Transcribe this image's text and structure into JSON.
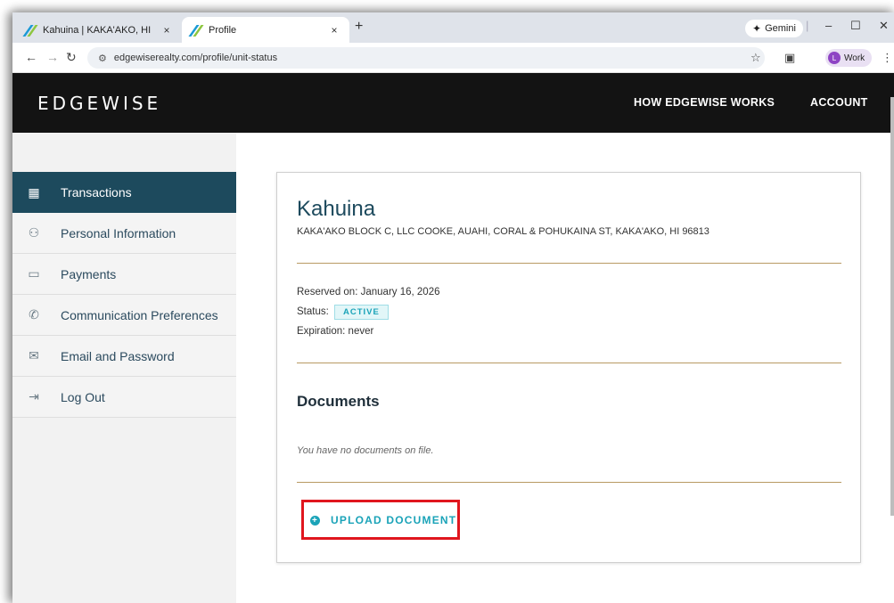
{
  "browser": {
    "tabs": [
      {
        "title": "Kahuina | KAKA'AKO, HI",
        "active": false
      },
      {
        "title": "Profile",
        "active": true
      }
    ],
    "close_glyph": "×",
    "new_tab_glyph": "+",
    "gemini_label": "Gemini",
    "url": "edgewiserealty.com/profile/unit-status",
    "profile_label": "Work",
    "profile_initial": "L"
  },
  "site": {
    "logo": "EDGEWISE",
    "nav": {
      "how": "HOW EDGEWISE WORKS",
      "account": "ACCOUNT"
    }
  },
  "sidebar": {
    "items": [
      {
        "label": "Transactions",
        "icon": "transactions-icon",
        "active": true
      },
      {
        "label": "Personal Information",
        "icon": "people-icon",
        "active": false
      },
      {
        "label": "Payments",
        "icon": "wallet-icon",
        "active": false
      },
      {
        "label": "Communication Preferences",
        "icon": "phone-icon",
        "active": false
      },
      {
        "label": "Email and Password",
        "icon": "mail-icon",
        "active": false
      },
      {
        "label": "Log Out",
        "icon": "logout-icon",
        "active": false
      }
    ]
  },
  "property": {
    "name": "Kahuina",
    "address": "KAKA'AKO BLOCK C, LLC COOKE, AUAHI, CORAL & POHUKAINA ST,  KAKA'AKO, HI 96813",
    "reserved_label": "Reserved on:",
    "reserved_date": "January 16, 2026",
    "status_label": "Status:",
    "status_value": "ACTIVE",
    "expiration_label": "Expiration:",
    "expiration_value": "never"
  },
  "documents": {
    "heading": "Documents",
    "empty_message": "You have no documents on file.",
    "upload_label": "UPLOAD DOCUMENT"
  },
  "colors": {
    "header_bg": "#131313",
    "sidebar_active": "#1d4a5d",
    "accent": "#1aa3b8",
    "divider": "#b89a63",
    "highlight": "#e0161e"
  }
}
